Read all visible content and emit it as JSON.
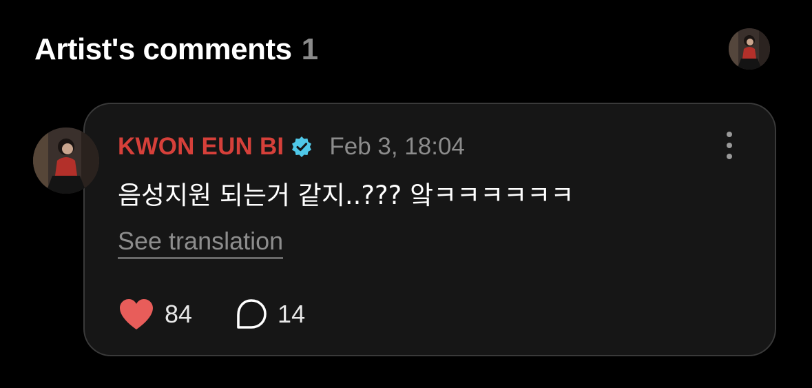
{
  "header": {
    "title": "Artist's comments",
    "count": "1"
  },
  "comment": {
    "author": "KWON EUN BI",
    "verified": true,
    "timestamp": "Feb 3, 18:04",
    "text": "음성지원 되는거 같지..??? 앜ㅋㅋㅋㅋㅋㅋ",
    "see_translation": "See translation",
    "likes": "84",
    "replies": "14"
  },
  "colors": {
    "background": "#000000",
    "card": "#161616",
    "author": "#d6403a",
    "heart": "#e85d5a",
    "verified_badge": "#4fc8e8",
    "muted": "#8c8c8c"
  },
  "icons": {
    "verified": "verified-badge-icon",
    "more": "more-vertical-icon",
    "like": "heart-icon",
    "reply": "speech-bubble-icon"
  }
}
